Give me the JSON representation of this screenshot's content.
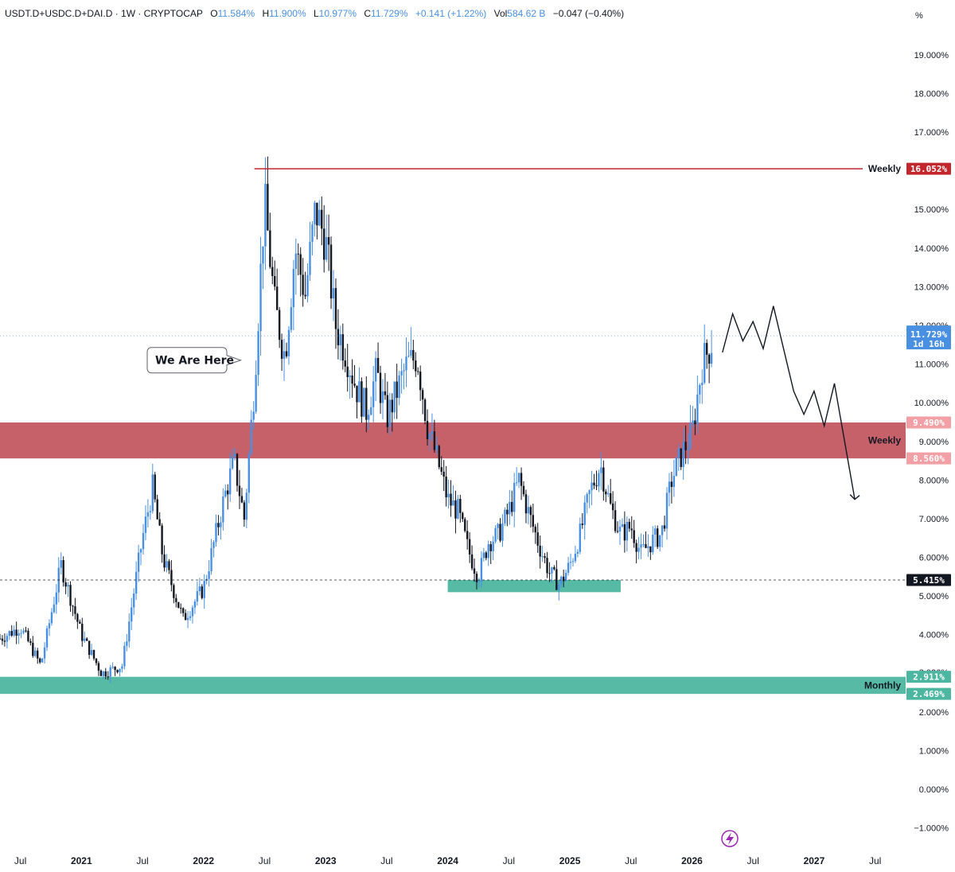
{
  "header": {
    "symbol": "USDT.D+USDC.D+DAI.D · 1W · CRYPTOCAP",
    "o_label": "O",
    "o_value": "11.584%",
    "h_label": "H",
    "h_value": "11.900%",
    "l_label": "L",
    "l_value": "10.977%",
    "c_label": "C",
    "c_value": "11.729%",
    "change": "+0.141 (+1.22%)",
    "vol_label": "Vol",
    "vol_value": "584.62 B",
    "vol_change": "−0.047 (−0.40%)"
  },
  "colors": {
    "up": "#4a90e2",
    "down": "#131722",
    "resistance_zone": "#c0505a",
    "support_zone": "#4db6a0",
    "weekly_line": "#c1272d",
    "current_badge": "#4a90e2"
  },
  "chart_data": {
    "type": "candlestick",
    "title": "",
    "x_axis": {
      "labels": [
        "Jul",
        "2021",
        "Jul",
        "2022",
        "Jul",
        "2023",
        "Jul",
        "2024",
        "Jul",
        "2025",
        "Jul",
        "2026",
        "Jul",
        "2027",
        "Jul"
      ],
      "dates": [
        "2020-07",
        "2021-01",
        "2021-07",
        "2022-01",
        "2022-07",
        "2023-01",
        "2023-07",
        "2024-01",
        "2024-07",
        "2025-01",
        "2025-07",
        "2026-01",
        "2026-07",
        "2027-01",
        "2027-07"
      ],
      "range": [
        "2020-05",
        "2027-10"
      ]
    },
    "y_axis": {
      "unit": "%",
      "range": [
        -1.5,
        19.8
      ],
      "ticks": [
        "19.000%",
        "18.000%",
        "17.000%",
        "15.000%",
        "14.000%",
        "13.000%",
        "12.000%",
        "11.000%",
        "10.000%",
        "9.000%",
        "8.000%",
        "7.000%",
        "6.000%",
        "5.000%",
        "4.000%",
        "3.026%",
        "2.000%",
        "1.000%",
        "0.000%",
        "−1.000%"
      ],
      "tick_values": [
        19,
        18,
        17,
        15,
        14,
        13,
        12,
        11,
        10,
        9,
        8,
        7,
        6,
        5,
        4,
        3.026,
        2,
        1,
        0,
        -1
      ],
      "position": "right"
    },
    "path_points": [
      [
        "2020-05",
        3.9
      ],
      [
        "2020-07",
        4.2
      ],
      [
        "2020-09",
        3.2
      ],
      [
        "2020-11",
        5.8
      ],
      [
        "2021-01",
        4.0
      ],
      [
        "2021-03",
        3.0
      ],
      [
        "2021-05",
        3.2
      ],
      [
        "2021-07",
        6.5
      ],
      [
        "2021-08",
        7.8
      ],
      [
        "2021-09",
        6.0
      ],
      [
        "2021-11",
        4.4
      ],
      [
        "2022-01",
        5.2
      ],
      [
        "2022-03",
        7.5
      ],
      [
        "2022-04",
        8.5
      ],
      [
        "2022-05",
        7.0
      ],
      [
        "2022-06",
        10.5
      ],
      [
        "2022-07",
        15.2
      ],
      [
        "2022-08",
        12.5
      ],
      [
        "2022-09",
        11.2
      ],
      [
        "2022-10",
        14.0
      ],
      [
        "2022-11",
        12.8
      ],
      [
        "2022-12",
        15.0
      ],
      [
        "2023-01",
        14.2
      ],
      [
        "2023-02",
        12.0
      ],
      [
        "2023-03",
        11.3
      ],
      [
        "2023-04",
        10.4
      ],
      [
        "2023-05",
        9.8
      ],
      [
        "2023-06",
        10.8
      ],
      [
        "2023-07",
        9.6
      ],
      [
        "2023-09",
        11.0
      ],
      [
        "2023-10",
        11.2
      ],
      [
        "2023-11",
        9.4
      ],
      [
        "2023-12",
        8.5
      ],
      [
        "2024-01",
        7.5
      ],
      [
        "2024-02",
        7.2
      ],
      [
        "2024-03",
        6.2
      ],
      [
        "2024-04",
        5.5
      ],
      [
        "2024-05",
        6.4
      ],
      [
        "2024-06",
        6.6
      ],
      [
        "2024-07",
        7.2
      ],
      [
        "2024-08",
        8.0
      ],
      [
        "2024-09",
        7.1
      ],
      [
        "2024-10",
        6.3
      ],
      [
        "2024-11",
        5.6
      ],
      [
        "2024-12",
        5.3
      ],
      [
        "2025-01",
        5.8
      ],
      [
        "2025-02",
        6.6
      ],
      [
        "2025-03",
        7.7
      ],
      [
        "2025-04",
        8.4
      ],
      [
        "2025-05",
        7.3
      ],
      [
        "2025-06",
        6.6
      ],
      [
        "2025-07",
        6.8
      ],
      [
        "2025-08",
        6.1
      ],
      [
        "2025-09",
        6.4
      ],
      [
        "2025-10",
        6.6
      ],
      [
        "2025-11",
        8.0
      ],
      [
        "2025-12",
        8.7
      ],
      [
        "2026-01",
        9.2
      ],
      [
        "2026-02",
        11.0
      ],
      [
        "2026-03",
        11.6
      ]
    ],
    "projection": {
      "points": [
        [
          "2026-04",
          11.3
        ],
        [
          "2026-05",
          12.3
        ],
        [
          "2026-06",
          11.6
        ],
        [
          "2026-07",
          12.1
        ],
        [
          "2026-08",
          11.4
        ],
        [
          "2026-09",
          12.5
        ],
        [
          "2026-11",
          10.3
        ],
        [
          "2026-12",
          9.7
        ],
        [
          "2027-01",
          10.3
        ],
        [
          "2027-02",
          9.4
        ],
        [
          "2027-03",
          10.5
        ],
        [
          "2027-05",
          7.5
        ]
      ],
      "arrow": true
    },
    "current": {
      "value": 11.729,
      "label": "11.729%",
      "countdown": "1d 16h"
    },
    "annotations": [
      {
        "type": "callout",
        "text": "We Are Here",
        "points_to": [
          "2022-07",
          11.1
        ]
      }
    ],
    "levels": [
      {
        "type": "line",
        "value": 16.052,
        "label": "Weekly",
        "badge": "16.052%",
        "from": "2022-06"
      },
      {
        "type": "zone",
        "top": 9.49,
        "bottom": 8.56,
        "label": "Weekly",
        "top_badge": "9.490%",
        "bottom_badge": "8.560%"
      },
      {
        "type": "zone",
        "top": 2.911,
        "bottom": 2.469,
        "label": "Monthly",
        "top_badge": "2.911%",
        "bottom_badge": "2.469%"
      },
      {
        "type": "zone",
        "top": 5.415,
        "bottom": 5.1,
        "label": "",
        "from": "2024-01",
        "to": "2025-06"
      },
      {
        "type": "dashed",
        "value": 5.415,
        "badge": "5.415%"
      }
    ],
    "grid": false
  }
}
